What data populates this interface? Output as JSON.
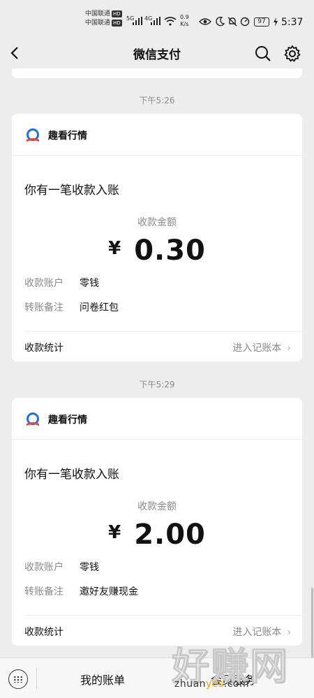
{
  "status_bar": {
    "carrier1": "中国联通",
    "carrier2": "中国联通",
    "hd": "HD",
    "net1": "5G",
    "net2": "4G",
    "speed_value": "0.9",
    "speed_unit": "K/s",
    "battery": "97",
    "time": "5:37"
  },
  "nav": {
    "title": "微信支付",
    "back_icon": "chevron-left-icon",
    "search_icon": "search-icon",
    "settings_icon": "gear-icon"
  },
  "messages": [
    {
      "time": "下午5:26",
      "merchant": "趣看行情",
      "headline": "你有一笔收款入账",
      "amount_label": "收款金额",
      "currency": "¥",
      "amount": "0.30",
      "account_label": "收款账户",
      "account_value": "零钱",
      "note_label": "转账备注",
      "note_value": "问卷红包",
      "footer_label": "收款统计",
      "footer_link": "进入记账本"
    },
    {
      "time": "下午5:29",
      "merchant": "趣看行情",
      "headline": "你有一笔收款入账",
      "amount_label": "收款金额",
      "currency": "¥",
      "amount": "2.00",
      "account_label": "收款账户",
      "account_value": "零钱",
      "note_label": "转账备注",
      "note_value": "邀好友赚现金",
      "footer_label": "收款统计",
      "footer_link": "进入记账本"
    }
  ],
  "bottom_bar": {
    "item1": "我的账单",
    "item2": "会员服务"
  },
  "watermark": {
    "big": "好赚网",
    "small_prefix": "zhuan",
    "small_hl": "yes",
    "small_suffix": ".com"
  },
  "colors": {
    "background": "#ededed",
    "card": "#ffffff",
    "secondary_text": "#8a8a8a",
    "logo_blue": "#1f6fe5",
    "logo_red": "#e8453c"
  }
}
